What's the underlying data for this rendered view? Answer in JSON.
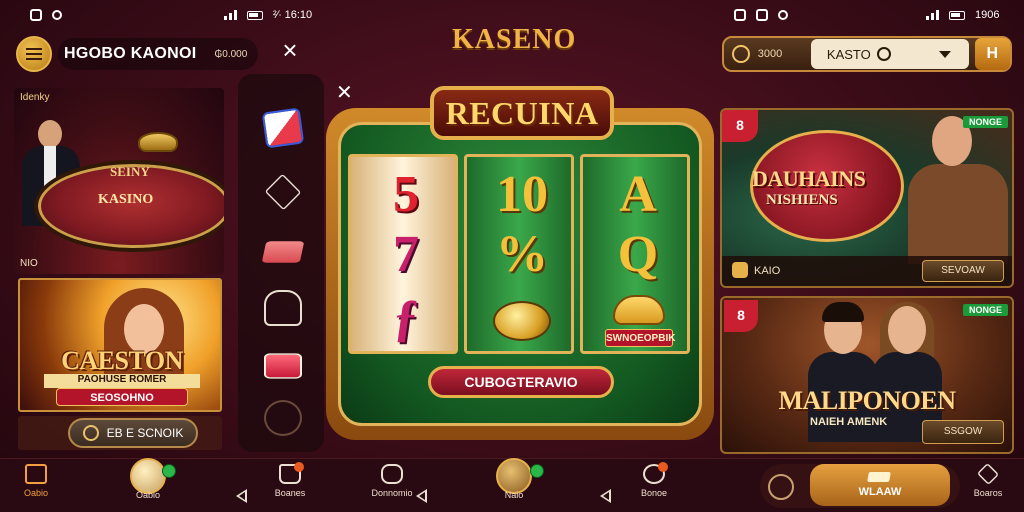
{
  "status_left": {
    "time": ""
  },
  "status_left_text": "²∕∙ 16:10",
  "status_right_text": "1906",
  "header_left": {
    "brand": "HGOBO KAONOI",
    "amount": "₲0.000"
  },
  "logo": "KASENO",
  "live_tile": {
    "tag": "Idenky",
    "table_line1": "SEINY",
    "table_line2": "KASINO",
    "footer": "NIO"
  },
  "game_tile": {
    "title": "CAESTON",
    "subtitle": "PAOHUSE ROMER",
    "badge": "SEOSOHNO",
    "button": "EB E SCNOIK"
  },
  "slot": {
    "title": "RECUINA",
    "reel1": [
      "5",
      "7",
      "ƒ"
    ],
    "reel2": [
      "10",
      "%",
      ""
    ],
    "reel3": [
      "A",
      "Q",
      ""
    ],
    "heart_label": "SWNOEOPBIK",
    "spin_label": "CUBOGTERAVIO"
  },
  "right_header": {
    "amount": "3000",
    "search_value": "KASTO",
    "button": "H"
  },
  "card_a": {
    "ribbon": "8",
    "tag": "NONGE",
    "title": "DAUHAINS",
    "subtitle": "NISHIENS",
    "price": "KAIO",
    "button": "SEVOAW"
  },
  "card_b": {
    "ribbon": "8",
    "tag": "NONGE",
    "title": "MALIPONOEN",
    "subtitle": "NAIEH AMENK",
    "button": "SSGOW"
  },
  "bottom_nav": {
    "items": [
      "Oabio",
      "Oabio",
      "Boanes",
      "Donnomio",
      "Naio",
      "Bonoe",
      "Boaros"
    ],
    "play_label": "WLAAW"
  },
  "colors": {
    "accent_gold": "#e6b04a",
    "bg_maroon": "#3a0c18",
    "felt_green": "#145a22",
    "badge_red": "#b3142a",
    "tag_green": "#1b9a3a"
  }
}
